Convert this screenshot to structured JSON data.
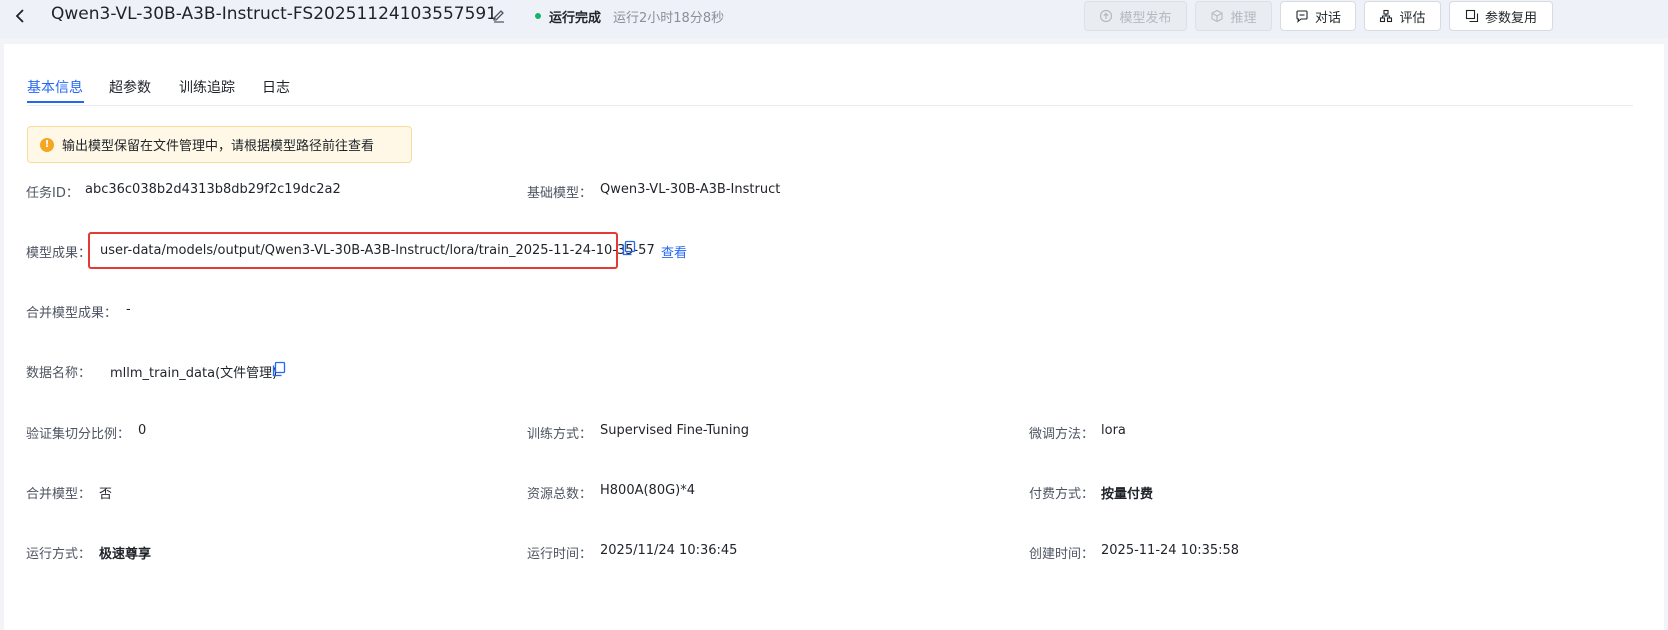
{
  "header": {
    "title": "Qwen3-VL-30B-A3B-Instruct-FS20251124103557591",
    "status": "运行完成",
    "duration": "运行2小时18分8秒",
    "buttons": {
      "publish": "模型发布",
      "inference": "推理",
      "chat": "对话",
      "evaluate": "评估",
      "reuse": "参数复用"
    }
  },
  "tabs": [
    "基本信息",
    "超参数",
    "训练追踪",
    "日志"
  ],
  "alert": {
    "text": "输出模型保留在文件管理中，请根据模型路径前往查看"
  },
  "info": {
    "task_id": {
      "label": "任务ID：",
      "value": "abc36c038b2d4313b8db29f2c19dc2a2"
    },
    "base_model": {
      "label": "基础模型：",
      "value": "Qwen3-VL-30B-A3B-Instruct"
    },
    "model_output": {
      "label": "模型成果：",
      "value": "user-data/models/output/Qwen3-VL-30B-A3B-Instruct/lora/train_2025-11-24-10-35-57",
      "view_link": "查看"
    },
    "merged_output": {
      "label": "合并模型成果：",
      "value": "-"
    },
    "data_name": {
      "label": "数据名称：",
      "value": "mllm_train_data(文件管理)"
    },
    "val_split": {
      "label": "验证集切分比例：",
      "value": "0"
    },
    "train_method": {
      "label": "训练方式：",
      "value": "Supervised Fine-Tuning"
    },
    "finetune_method": {
      "label": "微调方法：",
      "value": "lora"
    },
    "merge_model": {
      "label": "合并模型：",
      "value": "否"
    },
    "resources": {
      "label": "资源总数：",
      "value": "H800A(80G)*4"
    },
    "payment": {
      "label": "付费方式：",
      "value": "按量付费"
    },
    "run_mode": {
      "label": "运行方式：",
      "value": "极速尊享"
    },
    "run_time": {
      "label": "运行时间：",
      "value": "2025/11/24 10:36:45"
    },
    "created_time": {
      "label": "创建时间：",
      "value": "2025-11-24 10:35:58"
    }
  },
  "colors": {
    "accent": "#2468f2",
    "success": "#16b36a",
    "warning": "#f5a623",
    "highlight_border": "#e53935"
  }
}
